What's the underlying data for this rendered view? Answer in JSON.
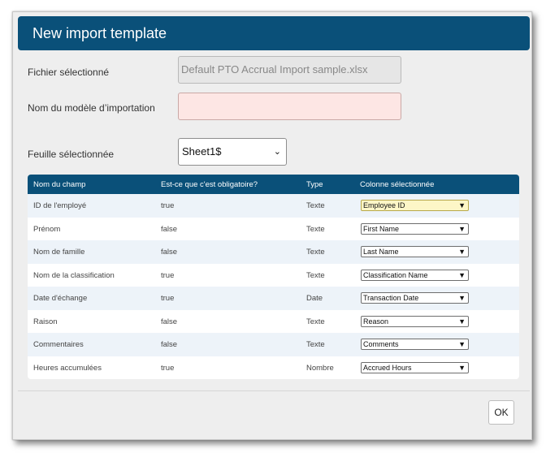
{
  "dialog": {
    "title": "New import template"
  },
  "form": {
    "file_label": "Fichier sélectionné",
    "file_value": "Default PTO Accrual Import sample.xlsx",
    "template_name_label": "Nom du modèle d’importation",
    "template_name_value": "",
    "sheet_label": "Feuille sélectionnée",
    "sheet_value": "Sheet1$"
  },
  "table": {
    "headers": [
      "Nom du champ",
      "Est-ce que c'est obligatoire?",
      "Type",
      "Colonne sélectionnée"
    ],
    "rows": [
      {
        "field": "ID de l'employé",
        "required": "true",
        "type": "Texte",
        "column": "Employee ID"
      },
      {
        "field": "Prénom",
        "required": "false",
        "type": "Texte",
        "column": "First Name"
      },
      {
        "field": "Nom de famille",
        "required": "false",
        "type": "Texte",
        "column": "Last Name"
      },
      {
        "field": "Nom de la classification",
        "required": "true",
        "type": "Texte",
        "column": "Classification Name"
      },
      {
        "field": "Date d'échange",
        "required": "true",
        "type": "Date",
        "column": "Transaction Date"
      },
      {
        "field": "Raison",
        "required": "false",
        "type": "Texte",
        "column": "Reason"
      },
      {
        "field": "Commentaires",
        "required": "false",
        "type": "Texte",
        "column": "Comments"
      },
      {
        "field": "Heures accumulées",
        "required": "true",
        "type": "Nombre",
        "column": "Accrued Hours"
      }
    ]
  },
  "footer": {
    "ok_label": "OK"
  },
  "colors": {
    "header_blue": "#0a5079",
    "required_field_bg": "#fde6e4",
    "highlight_select_bg": "#fdf6c7"
  }
}
